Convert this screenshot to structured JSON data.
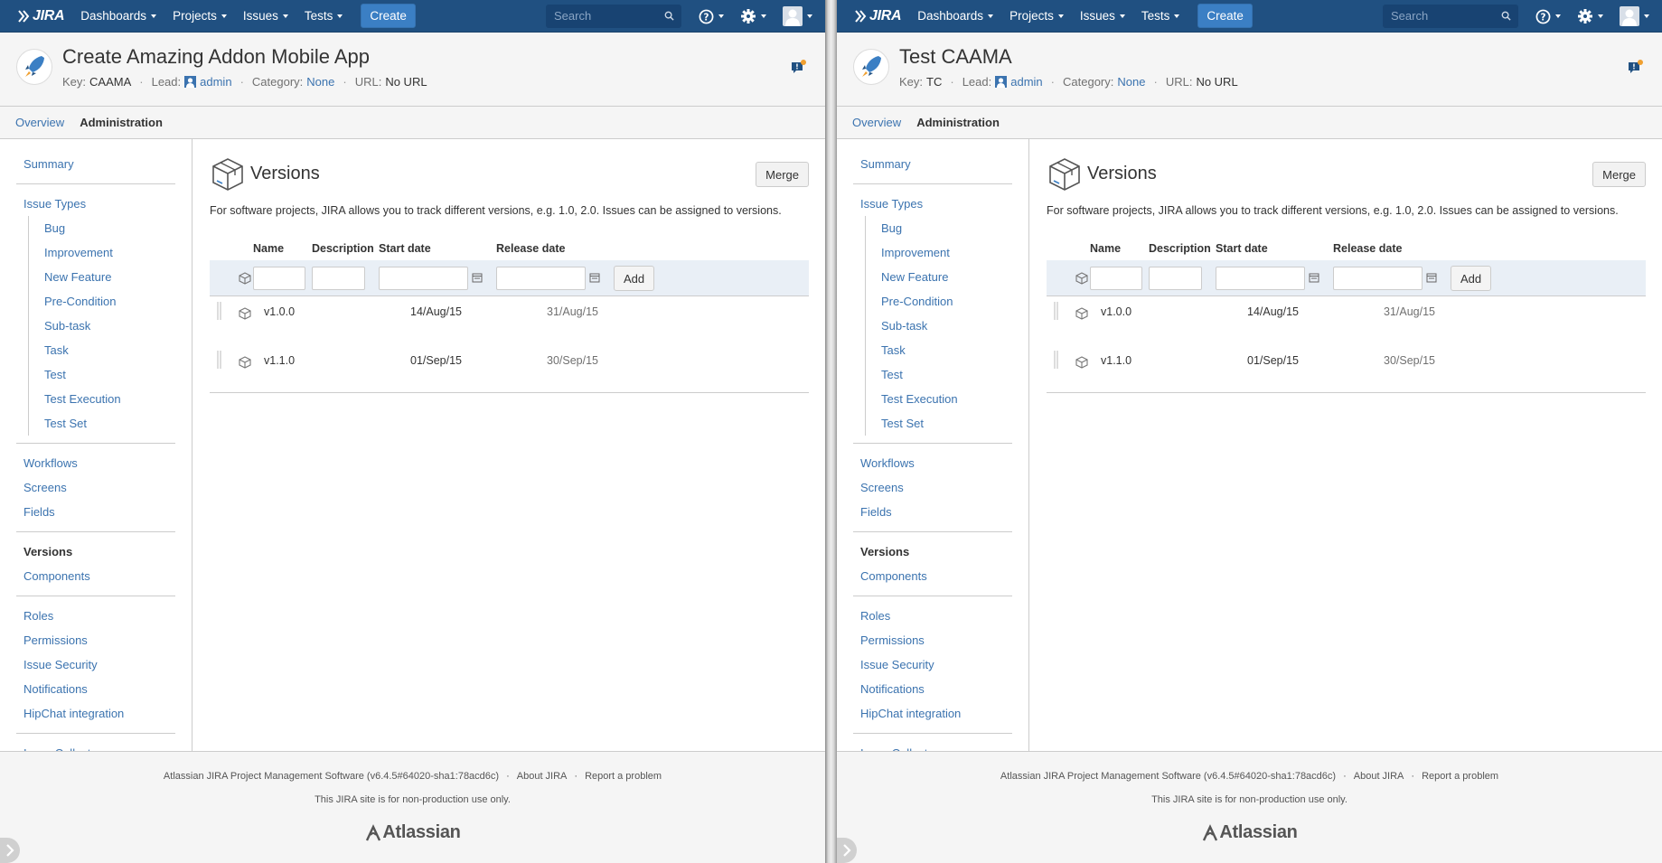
{
  "nav": {
    "logo": "JIRA",
    "menu": [
      "Dashboards",
      "Projects",
      "Issues",
      "Tests"
    ],
    "create_label": "Create",
    "search_placeholder": "Search"
  },
  "tabs": [
    "Overview",
    "Administration"
  ],
  "sidebar": {
    "groups": [
      [
        {
          "label": "Summary"
        }
      ],
      [
        {
          "label": "Issue Types"
        },
        {
          "sub": [
            "Bug",
            "Improvement",
            "New Feature",
            "Pre-Condition",
            "Sub-task",
            "Task",
            "Test",
            "Test Execution",
            "Test Set"
          ]
        }
      ],
      [
        {
          "label": "Workflows"
        },
        {
          "label": "Screens"
        },
        {
          "label": "Fields"
        }
      ],
      [
        {
          "label": "Versions",
          "active": true
        },
        {
          "label": "Components"
        }
      ],
      [
        {
          "label": "Roles"
        },
        {
          "label": "Permissions"
        },
        {
          "label": "Issue Security"
        },
        {
          "label": "Notifications"
        },
        {
          "label": "HipChat integration"
        }
      ],
      [
        {
          "label": "Issue Collectors"
        }
      ]
    ]
  },
  "versions": {
    "title": "Versions",
    "merge_label": "Merge",
    "description": "For software projects, JIRA allows you to track different versions, e.g. 1.0, 2.0. Issues can be assigned to versions.",
    "columns": {
      "name": "Name",
      "description": "Description",
      "start": "Start date",
      "release": "Release date"
    },
    "add_label": "Add",
    "rows": [
      {
        "name": "v1.0.0",
        "start": "14/Aug/15",
        "release": "31/Aug/15"
      },
      {
        "name": "v1.1.0",
        "start": "01/Sep/15",
        "release": "30/Sep/15"
      }
    ]
  },
  "footer": {
    "software": "Atlassian JIRA Project Management Software (v6.4.5#64020-sha1:78acd6c)",
    "about": "About JIRA",
    "report": "Report a problem",
    "note": "This JIRA site is for non-production use only.",
    "brand": "Atlassian"
  },
  "panes": [
    {
      "project": {
        "title": "Create Amazing Addon Mobile App",
        "key_label": "Key:",
        "key": "CAAMA",
        "lead_label": "Lead:",
        "lead": "admin",
        "category_label": "Category:",
        "category": "None",
        "url_label": "URL:",
        "url": "No URL"
      }
    },
    {
      "project": {
        "title": "Test CAAMA",
        "key_label": "Key:",
        "key": "TC",
        "lead_label": "Lead:",
        "lead": "admin",
        "category_label": "Category:",
        "category": "None",
        "url_label": "URL:",
        "url": "No URL"
      }
    }
  ],
  "colors": {
    "nav": "#205081",
    "link": "#3b73af",
    "create": "#3b7fc4"
  }
}
